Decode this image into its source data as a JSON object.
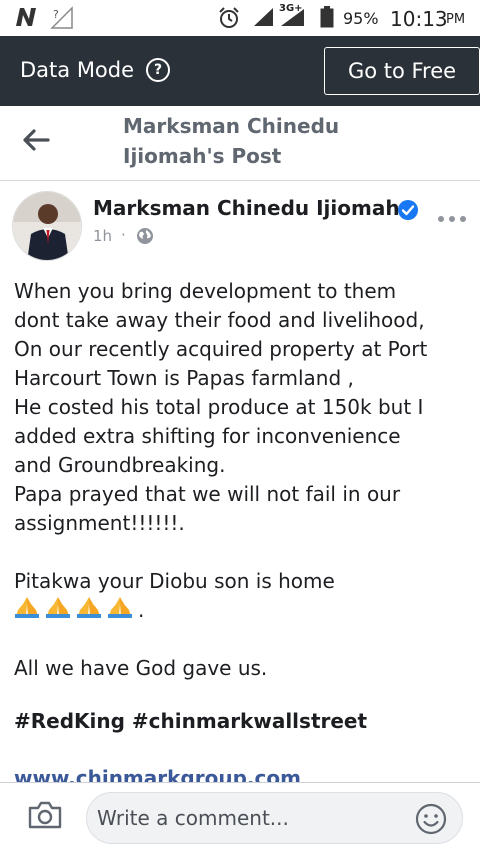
{
  "status_bar": {
    "carrier_icon": "n-notification-icon",
    "battery_percent": "95%",
    "time": "10:13",
    "ampm": "PM",
    "network_type": "3G+"
  },
  "data_mode": {
    "label": "Data Mode",
    "help_icon": "?",
    "button": "Go to Free"
  },
  "header": {
    "title": "Marksman Chinedu Ijiomah's Post",
    "back_icon": "back-arrow-icon"
  },
  "post": {
    "author": "Marksman Chinedu Ijiomah",
    "time_ago": "1h",
    "separator": "·",
    "privacy_icon": "globe-icon",
    "lines": [
      "When you bring development to them",
      "dont take away their food and livelihood,",
      "On our recently acquired property at Port",
      "Harcourt Town is Papas farmland ,",
      "He costed his total produce at 150k but I",
      "added extra shifting for inconvenience",
      "and Groundbreaking.",
      "Papa prayed that we will not fail in our",
      "assignment!!!!!!."
    ],
    "line_home": "Pitakwa your Diobu son is home",
    "pray_suffix": ".",
    "line_god": "All we have God gave us.",
    "hashtags": "#RedKing #chinmarkwallstreet",
    "link": "www.chinmarkgroup.com"
  },
  "comment": {
    "placeholder": "Write a comment..."
  },
  "colors": {
    "banner_bg": "#2a3138",
    "link": "#3b5998",
    "verified": "#1877f2",
    "muted": "#90949c"
  }
}
